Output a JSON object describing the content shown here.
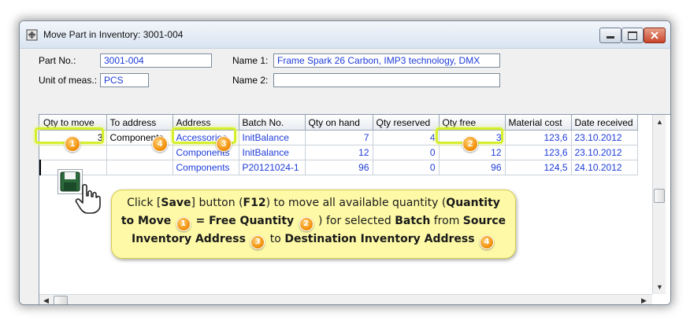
{
  "window": {
    "title": "Move Part in Inventory: 3001-004",
    "icons": {
      "app": "move-inventory-icon",
      "minimize": "minimize-icon",
      "maximize": "maximize-icon",
      "close": "close-icon"
    }
  },
  "form": {
    "part_no_label": "Part No.:",
    "part_no_value": "3001-004",
    "unit_label": "Unit of meas.:",
    "unit_value": "PCS",
    "name1_label": "Name 1:",
    "name1_value": "Frame Spark 26 Carbon, IMP3 technology, DMX",
    "name2_label": "Name 2:",
    "name2_value": ""
  },
  "grid": {
    "columns": [
      "Qty to move",
      "To address",
      "Address",
      "Batch No.",
      "Qty on hand",
      "Qty reserved",
      "Qty free",
      "Material cost",
      "Date received"
    ],
    "rows": [
      [
        "3",
        "Components",
        "Accessories",
        "InitBalance",
        "7",
        "4",
        "3",
        "123,6",
        "23.10.2012"
      ],
      [
        "",
        "",
        "Components",
        "InitBalance",
        "12",
        "0",
        "12",
        "123,6",
        "23.10.2012"
      ],
      [
        "",
        "",
        "Components",
        "P20121024-1",
        "96",
        "0",
        "96",
        "124,5",
        "24.10.2012"
      ]
    ]
  },
  "toolbar": {
    "save_icon": "save-floppy-icon",
    "cursor_icon": "hand-cursor-icon"
  },
  "badges": {
    "b1": "1",
    "b2": "2",
    "b3": "3",
    "b4": "4"
  },
  "callout": {
    "t1": "Click [",
    "t2": "Save",
    "t3": "] button (",
    "t4": "F12",
    "t5": ") to move all available quantity (",
    "t6": "Quantity",
    "t7": "to Move",
    "t8": " = ",
    "t9": "Free Quantity",
    "t10": " ) for selected ",
    "t11": "Batch",
    "t12": " from ",
    "t13": "Source",
    "t14": "Inventory Address",
    "t15": " to ",
    "t16": "Destination Inventory Address"
  },
  "colors": {
    "highlight": "#d6ef2c",
    "badge": "#f08a00",
    "callout_bg": "#fdf9a6",
    "value_text": "#1e3cd8"
  }
}
